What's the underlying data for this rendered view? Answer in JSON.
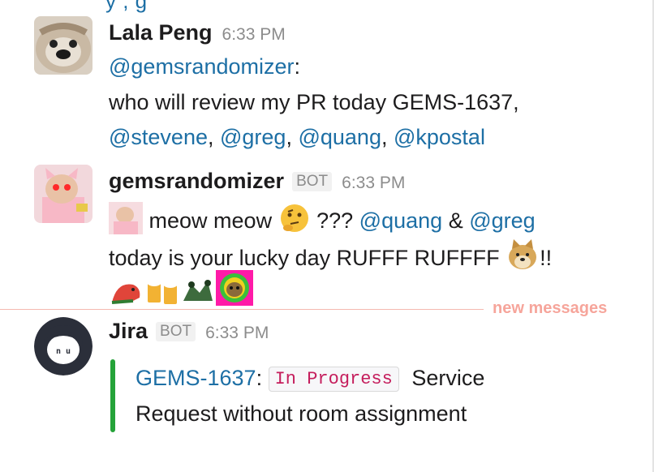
{
  "top_fragment": "y              ,              g",
  "messages": [
    {
      "author": "Lala Peng",
      "time": "6:33 PM",
      "line1_mention": "@gemsrandomizer",
      "line1_suffix": ":",
      "line2": "who will review my PR today GEMS-1637,",
      "mentions": [
        "@stevene",
        "@greg",
        "@quang",
        "@kpostal"
      ],
      "sep": ", "
    },
    {
      "author": "gemsrandomizer",
      "badge": "BOT",
      "time": "6:33 PM",
      "line1_text": "meow meow",
      "line1_q": "???",
      "line1_m1": "@quang",
      "line1_amp": "&",
      "line1_m2": "@greg",
      "line2_text": "today is your lucky day RUFFF RUFFFF",
      "line2_end": "!!",
      "emojis": [
        "cat-emoji",
        "thinking-face-emoji",
        "doge-emoji",
        "parrot-emoji",
        "beers-emoji",
        "dancing-emoji",
        "sloth-rainbow-emoji"
      ]
    },
    {
      "author": "Jira",
      "badge": "BOT",
      "time": "6:33 PM",
      "avatar_text": "n u",
      "issue_key": "GEMS-1637",
      "colon": ":",
      "status": "In Progress",
      "summary_part1": "Service",
      "summary_part2": "Request without room assignment",
      "accent_color": "#25a339"
    }
  ],
  "divider_label": "new messages",
  "colors": {
    "link": "#1d6fa5",
    "divider": "#f5b9b0",
    "divider_text": "#f6a59b"
  }
}
